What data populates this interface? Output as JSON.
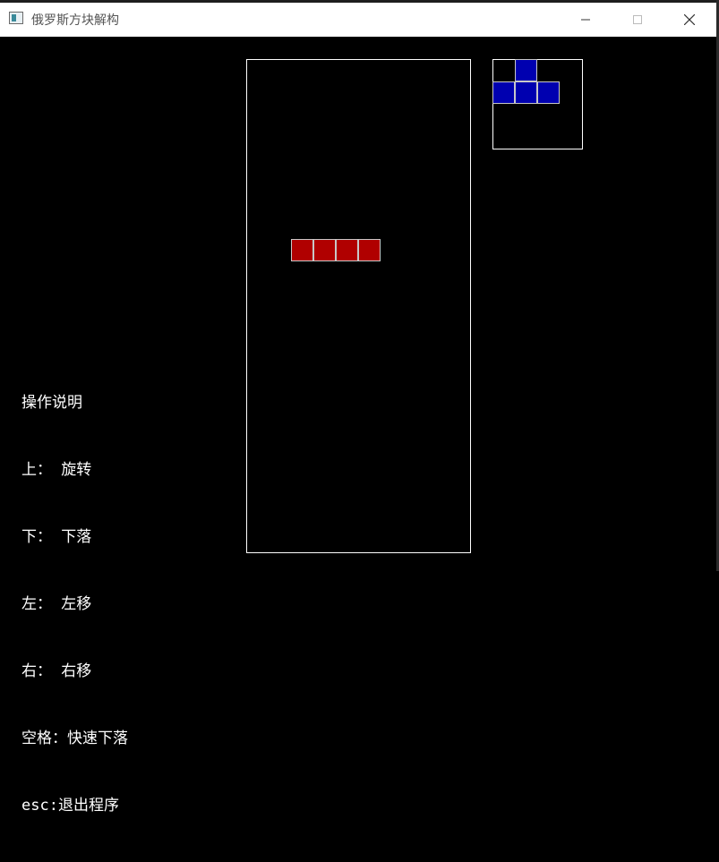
{
  "window": {
    "title": "俄罗斯方块解构",
    "icon": "app-window-icon",
    "controls": [
      "minimize-icon",
      "maximize-icon",
      "close-icon"
    ]
  },
  "colors": {
    "falling_piece": "#b00000",
    "next_piece": "#0000b0",
    "cell_border": "#c8c8c8",
    "board_border": "#ffffff",
    "background": "#000000"
  },
  "board": {
    "columns": 10,
    "rows": 22,
    "falling_piece": {
      "shape": "I",
      "cells": [
        [
          2,
          8
        ],
        [
          3,
          8
        ],
        [
          4,
          8
        ],
        [
          5,
          8
        ]
      ]
    }
  },
  "next_preview": {
    "columns": 4,
    "rows": 4,
    "piece": {
      "shape": "T",
      "cells": [
        [
          1,
          0
        ],
        [
          0,
          1
        ],
        [
          1,
          1
        ],
        [
          2,
          1
        ]
      ]
    }
  },
  "instructions": {
    "heading": "操作说明",
    "lines": [
      "上： 旋转",
      "下： 下落",
      "左： 左移",
      "右： 右移",
      "空格：快速下落",
      "esc:退出程序"
    ]
  }
}
